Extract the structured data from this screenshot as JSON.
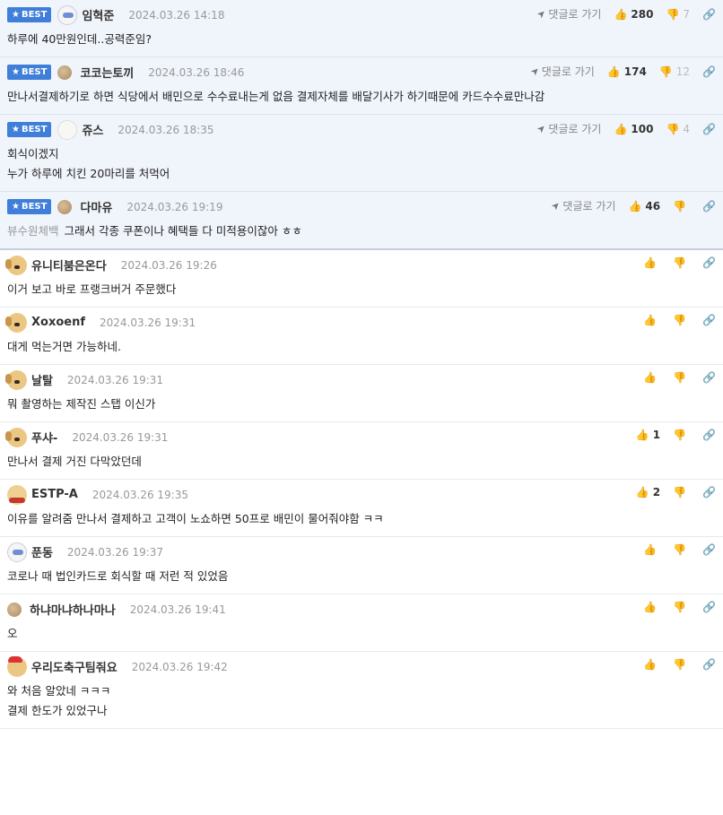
{
  "best_badge": "BEST",
  "reply_label": "댓글로 가기",
  "comments": [
    {
      "best": true,
      "avatar": "bear",
      "author": "임혁준",
      "date": "2024.03.26 14:18",
      "likes": "280",
      "dislikes": "7",
      "recipient": "",
      "text": "하루에 40만원인데..공력준임?"
    },
    {
      "best": true,
      "avatar": "dot",
      "author": "코코는토끼",
      "date": "2024.03.26 18:46",
      "likes": "174",
      "dislikes": "12",
      "recipient": "",
      "text": "만나서결제하기로 하면 식당에서 배민으로 수수료내는게 없음 결제자체를 배달기사가 하기때문에 카드수수료만나감"
    },
    {
      "best": true,
      "avatar": "white",
      "author": "쥬스",
      "date": "2024.03.26 18:35",
      "likes": "100",
      "dislikes": "4",
      "recipient": "",
      "text": "회식이겠지\n누가 하루에 치킨 20마리를 처먹어"
    },
    {
      "best": true,
      "avatar": "dot",
      "author": "다마유",
      "date": "2024.03.26 19:19",
      "likes": "46",
      "dislikes": "",
      "recipient": "뷰수원체백",
      "text": "그래서 각종 쿠폰이나 혜택들 다 미적용이잖아 ㅎㅎ"
    },
    {
      "best": false,
      "avatar": "dog",
      "author": "유니티붐은온다",
      "date": "2024.03.26 19:26",
      "likes": "",
      "dislikes": "",
      "recipient": "",
      "text": "이거 보고 바로 프랭크버거 주문했다"
    },
    {
      "best": false,
      "avatar": "dog",
      "author": "Xoxoenf",
      "date": "2024.03.26 19:31",
      "likes": "",
      "dislikes": "",
      "recipient": "",
      "text": "대게 먹는거면 가능하네."
    },
    {
      "best": false,
      "avatar": "dog",
      "author": "날탈",
      "date": "2024.03.26 19:31",
      "likes": "",
      "dislikes": "",
      "recipient": "",
      "text": "뭐 촬영하는 제작진 스탭 이신가"
    },
    {
      "best": false,
      "avatar": "dog",
      "author": "푸샤-",
      "date": "2024.03.26 19:31",
      "likes": "1",
      "dislikes": "",
      "recipient": "",
      "text": "만나서 결제 거진 다막았던데"
    },
    {
      "best": false,
      "avatar": "red",
      "author": "ESTP-A",
      "date": "2024.03.26 19:35",
      "likes": "2",
      "dislikes": "",
      "recipient": "",
      "text": "이유를 알려줌 만나서 결제하고 고객이 노쇼하면 50프로 배민이 물어줘야함 ㅋㅋ"
    },
    {
      "best": false,
      "avatar": "bear",
      "author": "푼동",
      "date": "2024.03.26 19:37",
      "likes": "",
      "dislikes": "",
      "recipient": "",
      "text": "코로나 때 법인카드로 회식할 때 저런 적 있었음"
    },
    {
      "best": false,
      "avatar": "dot",
      "author": "하냐마냐하나마나",
      "date": "2024.03.26 19:41",
      "likes": "",
      "dislikes": "",
      "recipient": "",
      "text": "오"
    },
    {
      "best": false,
      "avatar": "santa",
      "author": "우리도축구팀줘요",
      "date": "2024.03.26 19:42",
      "likes": "",
      "dislikes": "",
      "recipient": "",
      "text": "와 처음 알았네 ㅋㅋㅋ\n결제 한도가 있었구나"
    }
  ]
}
